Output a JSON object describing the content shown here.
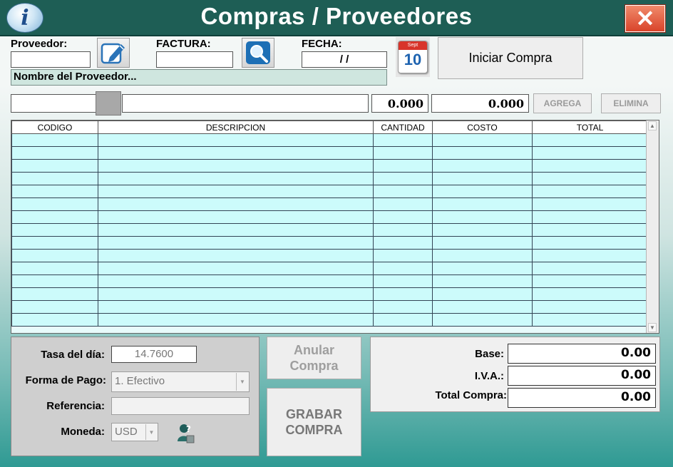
{
  "window": {
    "title": "Compras / Proveedores",
    "close_label": "✕"
  },
  "header": {
    "proveedor_label": "Proveedor:",
    "proveedor_value": "",
    "factura_label": "FACTURA:",
    "factura_value": "",
    "fecha_label": "FECHA:",
    "fecha_value": "/ /",
    "calendar_day": "10",
    "calendar_month": "Sept",
    "iniciar_label": "Iniciar Compra",
    "nombre_proveedor": "Nombre del Proveedor..."
  },
  "entry": {
    "codigo_value": "",
    "descripcion_value": "",
    "cantidad_value": "0.000",
    "costo_value": "0.000",
    "agrega_label": "AGREGA",
    "elimina_label": "ELIMINA"
  },
  "grid": {
    "columns": [
      "CODIGO",
      "DESCRIPCION",
      "CANTIDAD",
      "COSTO",
      "TOTAL"
    ],
    "row_count": 15
  },
  "payment": {
    "tasa_label": "Tasa del día:",
    "tasa_value": "14.7600",
    "forma_label": "Forma de Pago:",
    "forma_value": "1. Efectivo",
    "referencia_label": "Referencia:",
    "referencia_value": "",
    "moneda_label": "Moneda:",
    "moneda_value": "USD"
  },
  "actions": {
    "anular_label": "Anular\nCompra",
    "grabar_label": "GRABAR\nCOMPRA"
  },
  "totals": {
    "base_label": "Base:",
    "base_value": "0.00",
    "iva_label": "I.V.A.:",
    "iva_value": "0.00",
    "total_label": "Total Compra:",
    "total_value": "0.00"
  },
  "colors": {
    "titlebar": "#1e5e55",
    "grid_row": "#ccfbfb",
    "accent": "#2f9a93"
  },
  "icons": [
    "info-icon",
    "close-icon",
    "edit-pencil-icon",
    "search-magnifier-icon",
    "calendar-icon",
    "help-person-icon"
  ]
}
